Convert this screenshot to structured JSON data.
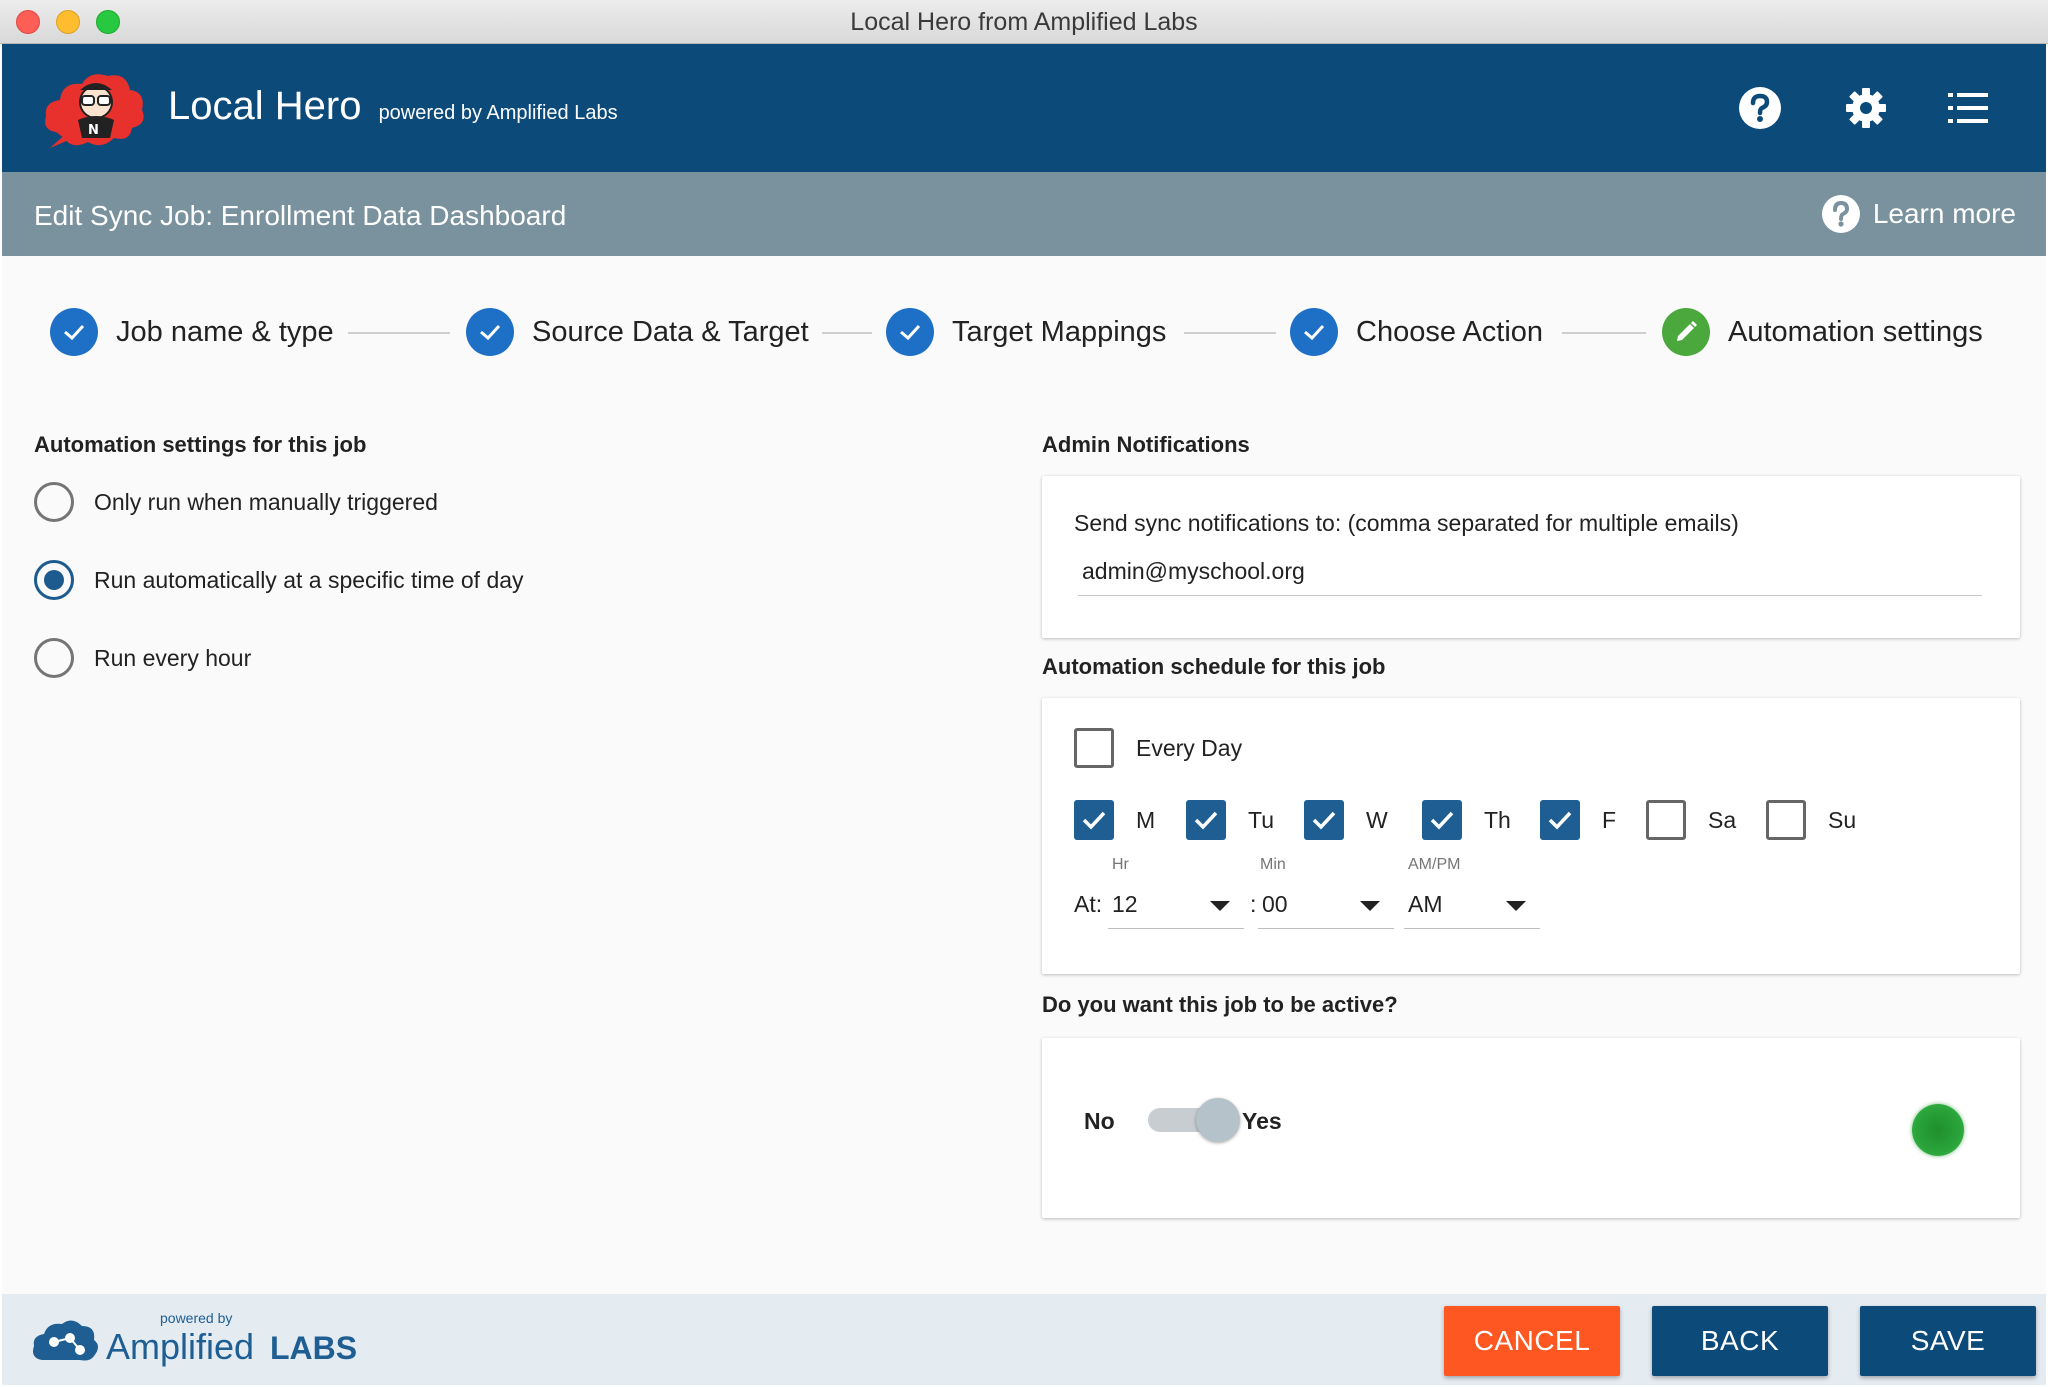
{
  "window": {
    "title": "Local Hero from Amplified Labs"
  },
  "header": {
    "brand": "Local Hero",
    "brand_sub": "powered by Amplified Labs",
    "icons": [
      "help-icon",
      "gear-icon",
      "list-menu-icon"
    ]
  },
  "subheader": {
    "title": "Edit Sync Job: Enrollment Data Dashboard",
    "learn_more": "Learn more"
  },
  "stepper": {
    "steps": [
      {
        "label": "Job name & type",
        "status": "complete"
      },
      {
        "label": "Source Data & Target",
        "status": "complete"
      },
      {
        "label": "Target Mappings",
        "status": "complete"
      },
      {
        "label": "Choose Action",
        "status": "complete"
      },
      {
        "label": "Automation settings",
        "status": "editing"
      }
    ]
  },
  "automation": {
    "title": "Automation settings for this job",
    "options": [
      {
        "label": "Only run when manually triggered",
        "selected": false
      },
      {
        "label": "Run automatically at a specific time of day",
        "selected": true
      },
      {
        "label": "Run every hour",
        "selected": false
      }
    ]
  },
  "notifications": {
    "title": "Admin Notifications",
    "label": "Send sync notifications to: (comma separated for multiple emails)",
    "value": "admin@myschool.org"
  },
  "schedule": {
    "title": "Automation schedule for this job",
    "every_day": {
      "label": "Every Day",
      "checked": false
    },
    "days": [
      {
        "label": "M",
        "checked": true
      },
      {
        "label": "Tu",
        "checked": true
      },
      {
        "label": "W",
        "checked": true
      },
      {
        "label": "Th",
        "checked": true
      },
      {
        "label": "F",
        "checked": true
      },
      {
        "label": "Sa",
        "checked": false
      },
      {
        "label": "Su",
        "checked": false
      }
    ],
    "at_label": "At:",
    "colon": ":",
    "hr_label": "Hr",
    "min_label": "Min",
    "ampm_label": "AM/PM",
    "hour": "12",
    "minute": "00",
    "ampm": "AM"
  },
  "active": {
    "title": "Do you want this job to be active?",
    "no_label": "No",
    "yes_label": "Yes",
    "toggle_on": false,
    "status_color": "#2e9d3a"
  },
  "footer": {
    "powered_by": "powered by",
    "brand_amplified": "Amplified",
    "brand_labs": "LABS",
    "cancel": "CANCEL",
    "back": "BACK",
    "save": "SAVE"
  },
  "colors": {
    "header": "#0c4a7a",
    "subheader": "#7a929e",
    "step_complete": "#1e6fc6",
    "step_current": "#4aa83c",
    "cancel": "#fe5721",
    "primary_button": "#0c4a7a"
  }
}
